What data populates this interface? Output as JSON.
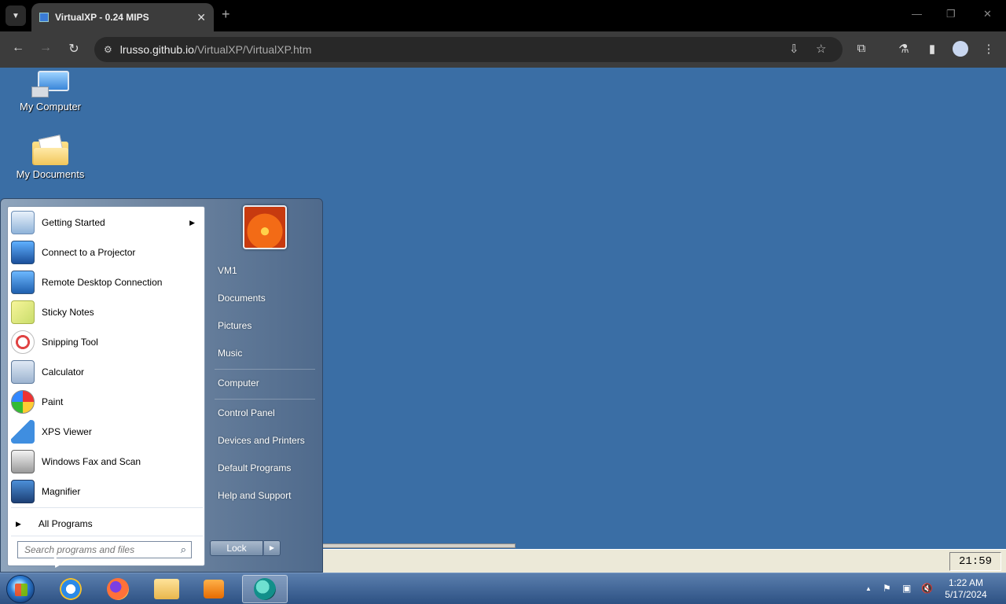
{
  "browser": {
    "tab_title": "VirtualXP - 0.24 MIPS",
    "url_host": "lrusso.github.io",
    "url_path": "/VirtualXP/VirtualXP.htm"
  },
  "desktop": {
    "icons": [
      {
        "label": "My Computer",
        "icon": "computer-icon"
      },
      {
        "label": "My Documents",
        "icon": "folder-icon"
      }
    ],
    "inner_clock": "21:59"
  },
  "start_menu": {
    "programs": [
      {
        "label": "Getting Started",
        "has_submenu": true
      },
      {
        "label": "Connect to a Projector"
      },
      {
        "label": "Remote Desktop Connection"
      },
      {
        "label": "Sticky Notes"
      },
      {
        "label": "Snipping Tool"
      },
      {
        "label": "Calculator"
      },
      {
        "label": "Paint"
      },
      {
        "label": "XPS Viewer"
      },
      {
        "label": "Windows Fax and Scan"
      },
      {
        "label": "Magnifier"
      }
    ],
    "all_programs": "All Programs",
    "search_placeholder": "Search programs and files",
    "right_links": [
      "VM1",
      "Documents",
      "Pictures",
      "Music",
      "Computer",
      "Control Panel",
      "Devices and Printers",
      "Default Programs",
      "Help and Support"
    ],
    "lock_label": "Lock"
  },
  "taskbar": {
    "apps": [
      "internet-explorer-icon",
      "firefox-icon",
      "file-explorer-icon",
      "media-player-icon",
      "virtualxp-icon"
    ],
    "time": "1:22 AM",
    "date": "5/17/2024"
  },
  "colors": {
    "desktop_bg": "#3a6ea5",
    "taskbar": "#2d5183"
  }
}
